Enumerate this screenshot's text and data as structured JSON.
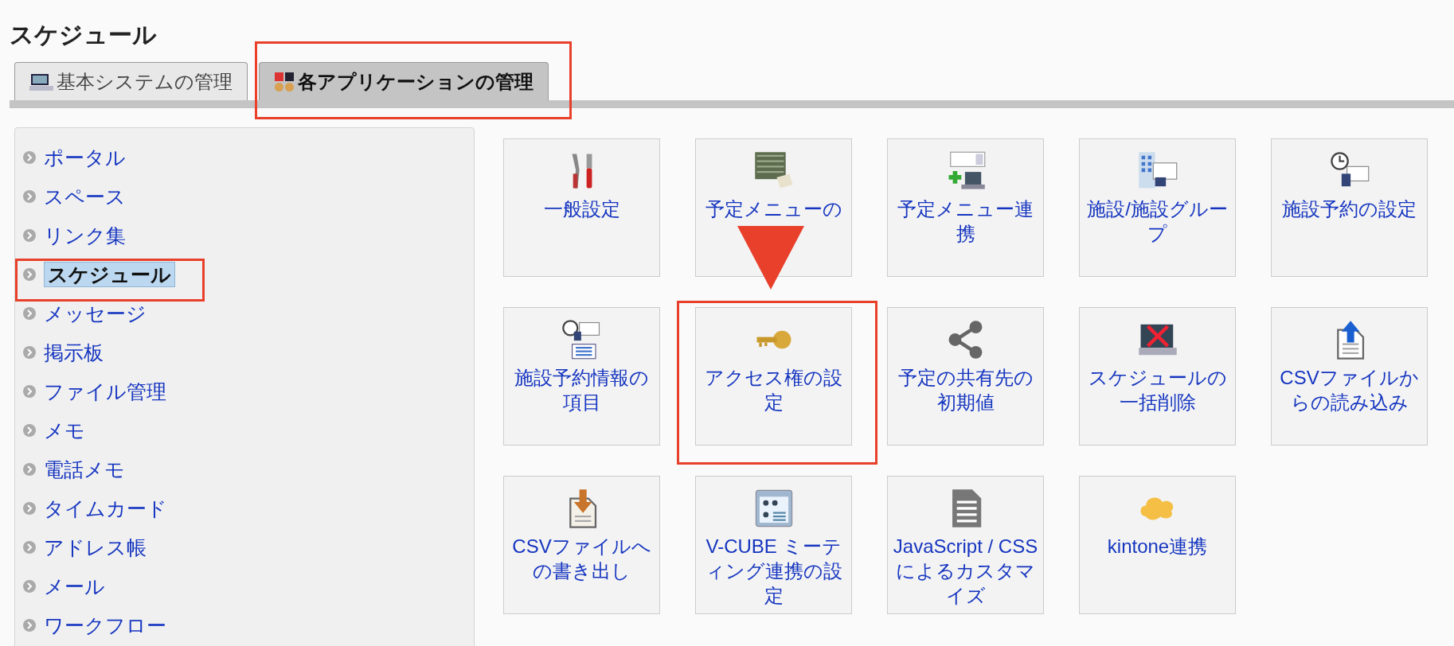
{
  "heading": "スケジュール",
  "tabs": [
    {
      "label": "基本システムの管理",
      "selected": false
    },
    {
      "label": "各アプリケーションの管理",
      "selected": true
    }
  ],
  "sidebar": {
    "items": [
      {
        "label": "ポータル",
        "selected": false
      },
      {
        "label": "スペース",
        "selected": false
      },
      {
        "label": "リンク集",
        "selected": false
      },
      {
        "label": "スケジュール",
        "selected": true
      },
      {
        "label": "メッセージ",
        "selected": false
      },
      {
        "label": "掲示板",
        "selected": false
      },
      {
        "label": "ファイル管理",
        "selected": false
      },
      {
        "label": "メモ",
        "selected": false
      },
      {
        "label": "電話メモ",
        "selected": false
      },
      {
        "label": "タイムカード",
        "selected": false
      },
      {
        "label": "アドレス帳",
        "selected": false
      },
      {
        "label": "メール",
        "selected": false
      },
      {
        "label": "ワークフロー",
        "selected": false
      }
    ]
  },
  "tiles": [
    {
      "label": "一般設定"
    },
    {
      "label": "予定メニューの"
    },
    {
      "label": "予定メニュー連携"
    },
    {
      "label": "施設/施設グループ"
    },
    {
      "label": "施設予約の設定"
    },
    {
      "label": "施設予約情報の項目"
    },
    {
      "label": "アクセス権の設定"
    },
    {
      "label": "予定の共有先の初期値"
    },
    {
      "label": "スケジュールの一括削除"
    },
    {
      "label": "CSVファイルからの読み込み"
    },
    {
      "label": "CSVファイルへの書き出し"
    },
    {
      "label": "V-CUBE ミーティング連携の設定"
    },
    {
      "label": "JavaScript / CSSによるカスタマイズ"
    },
    {
      "label": "kintone連携"
    }
  ]
}
